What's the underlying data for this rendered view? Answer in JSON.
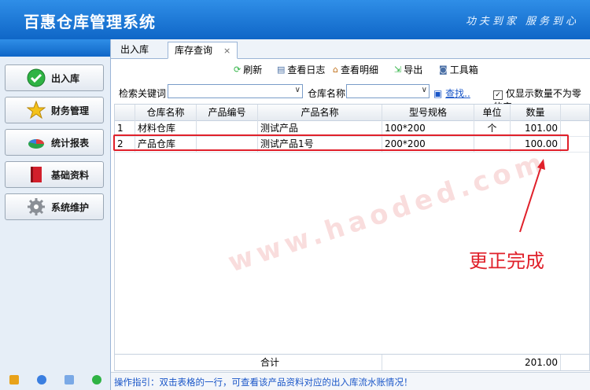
{
  "header": {
    "title": "百惠仓库管理系统",
    "slogan": "功夫到家 服务到心"
  },
  "sidebar": {
    "items": [
      {
        "label": "出入库",
        "icon": "check-circle-icon"
      },
      {
        "label": "财务管理",
        "icon": "star-icon"
      },
      {
        "label": "统计报表",
        "icon": "pie-chart-icon"
      },
      {
        "label": "基础资料",
        "icon": "book-icon"
      },
      {
        "label": "系统维护",
        "icon": "gear-icon"
      }
    ]
  },
  "tabs": [
    {
      "label": "出入库"
    },
    {
      "label": "库存查询",
      "close": "×"
    }
  ],
  "toolbar": {
    "refresh": "刷新",
    "view_log": "查看日志",
    "view_detail": "查看明细",
    "export": "导出",
    "toolbox": "工具箱"
  },
  "search": {
    "keyword_label": "检索关键词",
    "keyword_value": "",
    "warehouse_label": "仓库名称",
    "warehouse_value": "",
    "find_label": "查找..",
    "filter_label": "仅显示数量不为零的产"
  },
  "table": {
    "columns": [
      "",
      "仓库名称",
      "产品编号",
      "产品名称",
      "型号规格",
      "单位",
      "数量"
    ],
    "rows": [
      [
        "1",
        "材料仓库",
        "",
        "测试产品",
        "100*200",
        "个",
        "101.00"
      ],
      [
        "2",
        "产品仓库",
        "",
        "测试产品1号",
        "200*200",
        "",
        "100.00"
      ]
    ],
    "footer": {
      "label": "合计",
      "total": "201.00"
    }
  },
  "watermark": "www.haoded.com",
  "annotation": "更正完成",
  "status": "操作指引：双击表格的一行，可查看该产品资料对应的出入库流水账情况！",
  "colors": {
    "accent": "#1466c8",
    "highlight": "#e0202a"
  }
}
